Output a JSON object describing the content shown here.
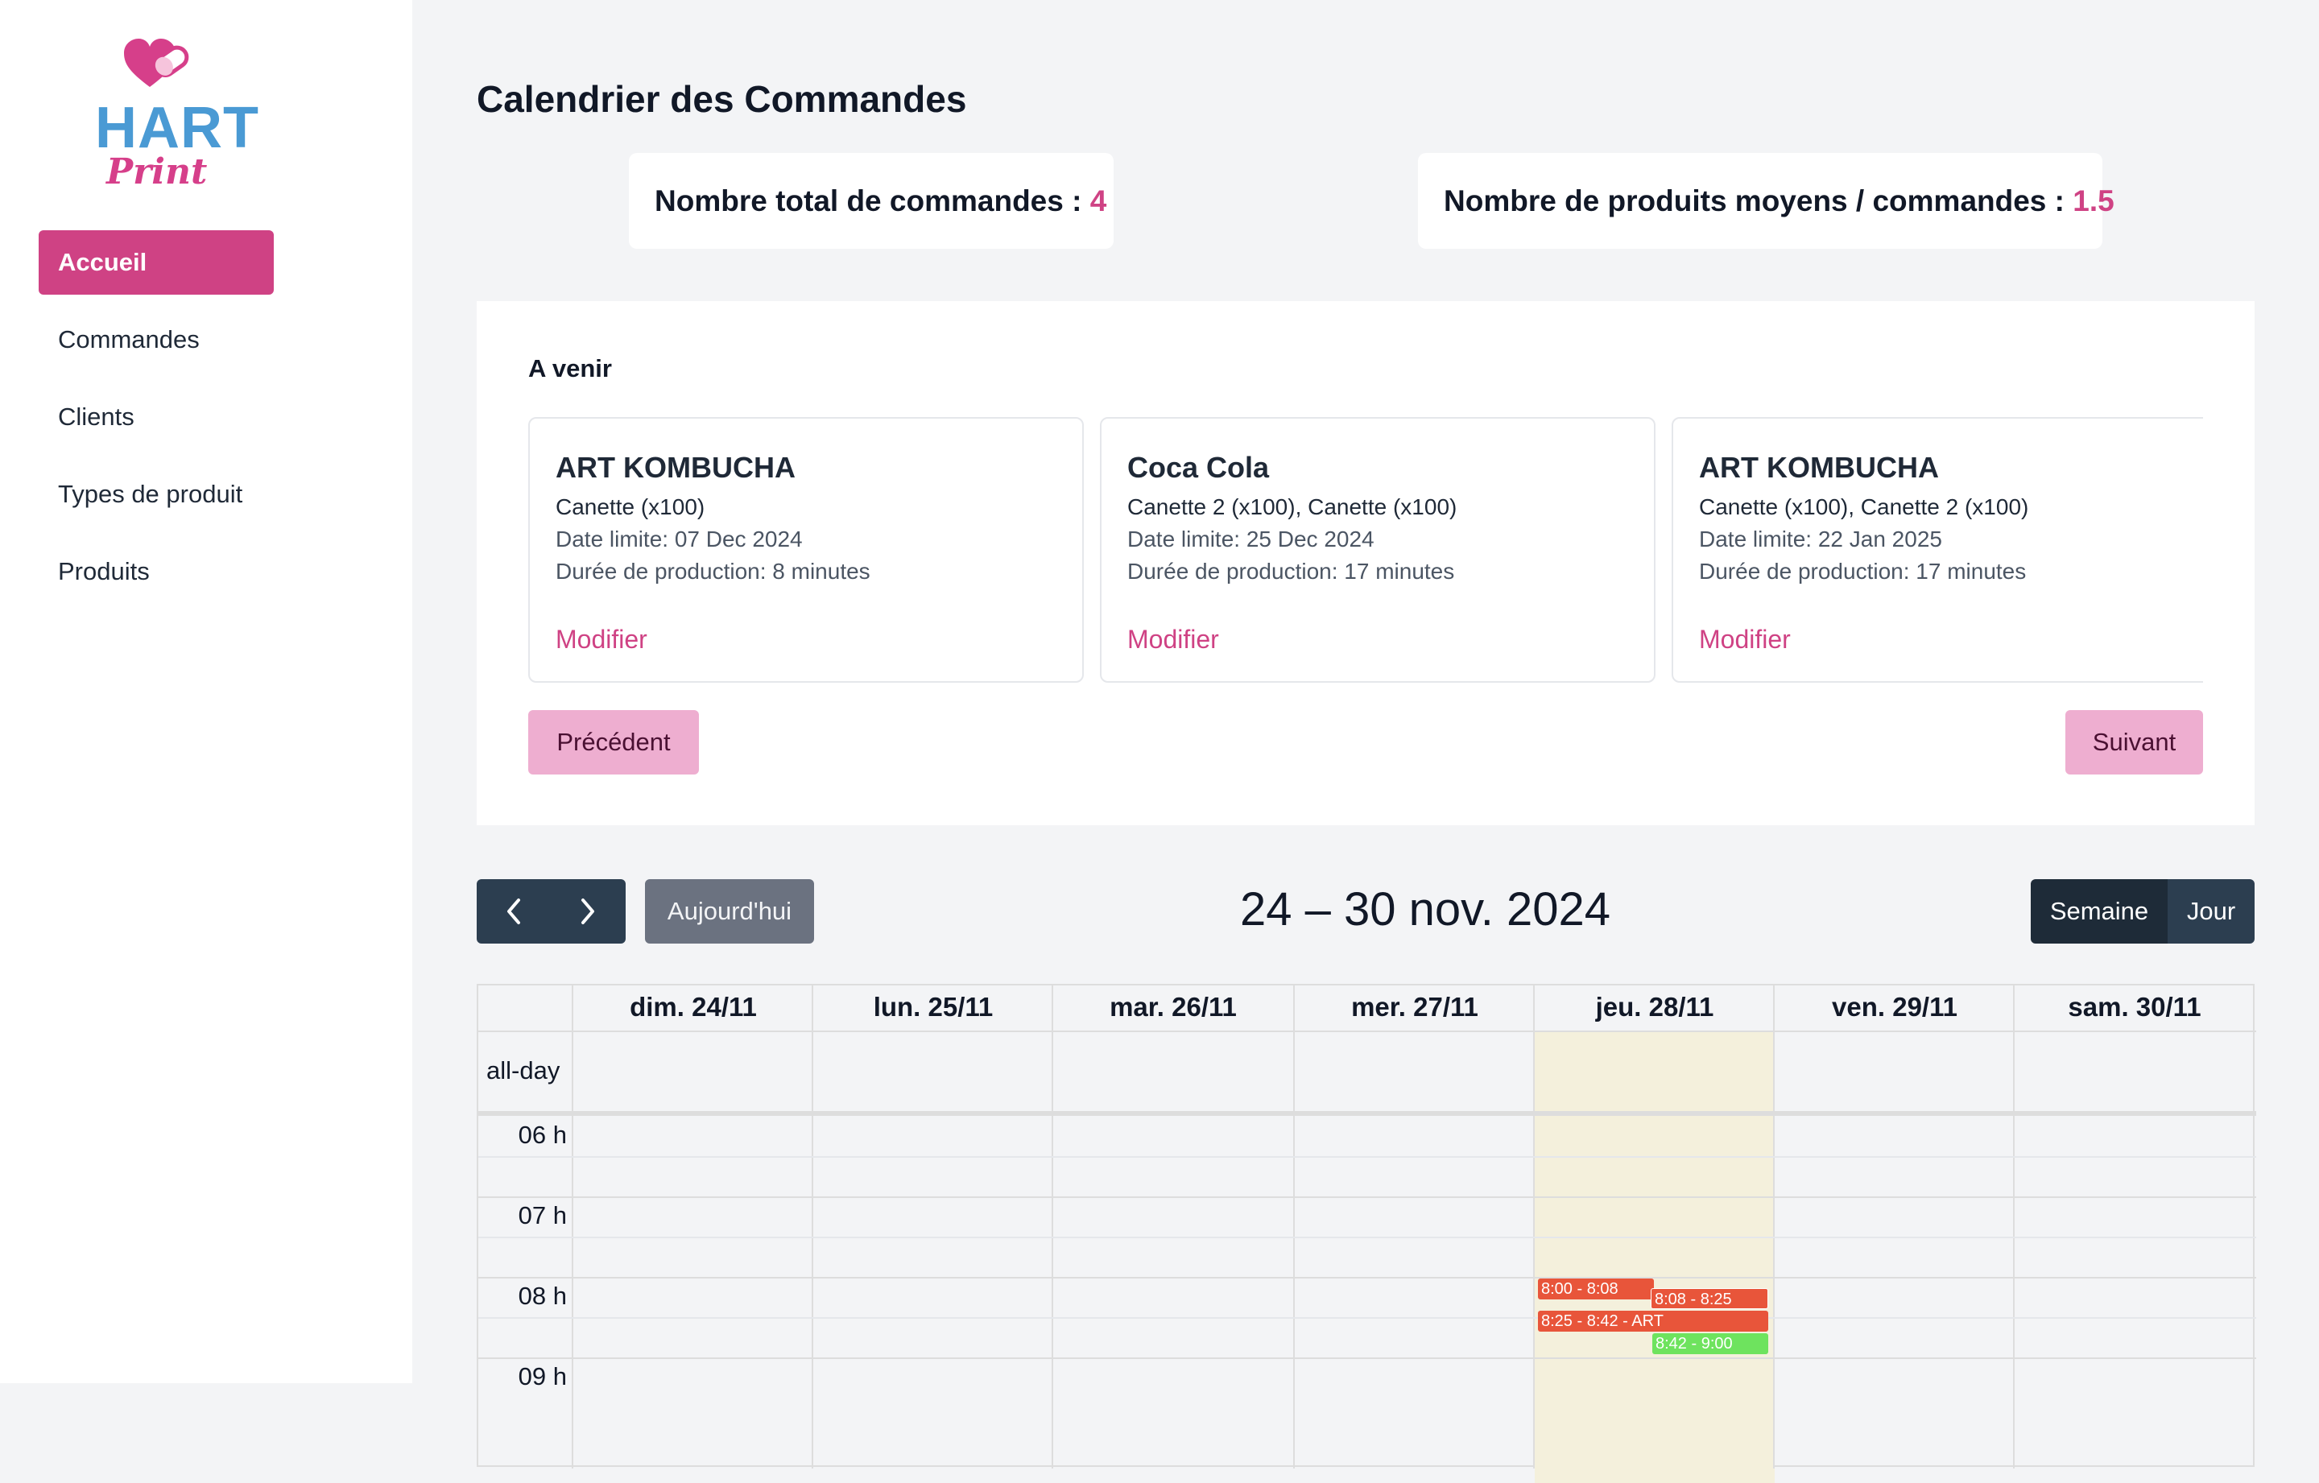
{
  "sidebar": {
    "logo": {
      "top": "HART",
      "bottom": "Print"
    },
    "items": [
      {
        "label": "Accueil",
        "active": true
      },
      {
        "label": "Commandes"
      },
      {
        "label": "Clients"
      },
      {
        "label": "Types de produit"
      },
      {
        "label": "Produits"
      }
    ]
  },
  "page": {
    "title": "Calendrier des Commandes"
  },
  "stats": {
    "total_label": "Nombre total de commandes :",
    "total_value": "4",
    "avg_label": "Nombre de produits moyens / commandes :",
    "avg_value": "1.5"
  },
  "upcoming": {
    "title": "A venir",
    "cards": [
      {
        "title": "ART KOMBUCHA",
        "products": "Canette (x100)",
        "date": "Date limite: 07 Dec 2024",
        "duration": "Durée de production: 8 minutes",
        "edit": "Modifier"
      },
      {
        "title": "Coca Cola",
        "products": "Canette 2 (x100), Canette (x100)",
        "date": "Date limite: 25 Dec 2024",
        "duration": "Durée de production: 17 minutes",
        "edit": "Modifier"
      },
      {
        "title": "ART KOMBUCHA",
        "products": "Canette (x100), Canette 2 (x100)",
        "date": "Date limite: 22 Jan 2025",
        "duration": "Durée de production: 17 minutes",
        "edit": "Modifier"
      }
    ],
    "prev_label": "Précédent",
    "next_label": "Suivant"
  },
  "calendar": {
    "today_label": "Aujourd'hui",
    "range": "24 – 30 nov. 2024",
    "views": {
      "week": "Semaine",
      "day": "Jour"
    },
    "days": [
      "dim. 24/11",
      "lun. 25/11",
      "mar. 26/11",
      "mer. 27/11",
      "jeu. 28/11",
      "ven. 29/11",
      "sam. 30/11"
    ],
    "allday_label": "all-day",
    "hours": [
      "06 h",
      "07 h",
      "08 h",
      "09 h"
    ],
    "events": [
      {
        "label": "8:00 - 8:08",
        "color": "#e8553a"
      },
      {
        "label": "8:08 - 8:25",
        "color": "#e8553a"
      },
      {
        "label": "8:25 - 8:42 - ART",
        "color": "#e8553a"
      },
      {
        "label": "8:42 - 9:00",
        "color": "#6ee35e"
      }
    ]
  },
  "colors": {
    "accent": "#cf4284",
    "nav_dark": "#2c3e50",
    "today_bg": "#f4f0dc"
  }
}
